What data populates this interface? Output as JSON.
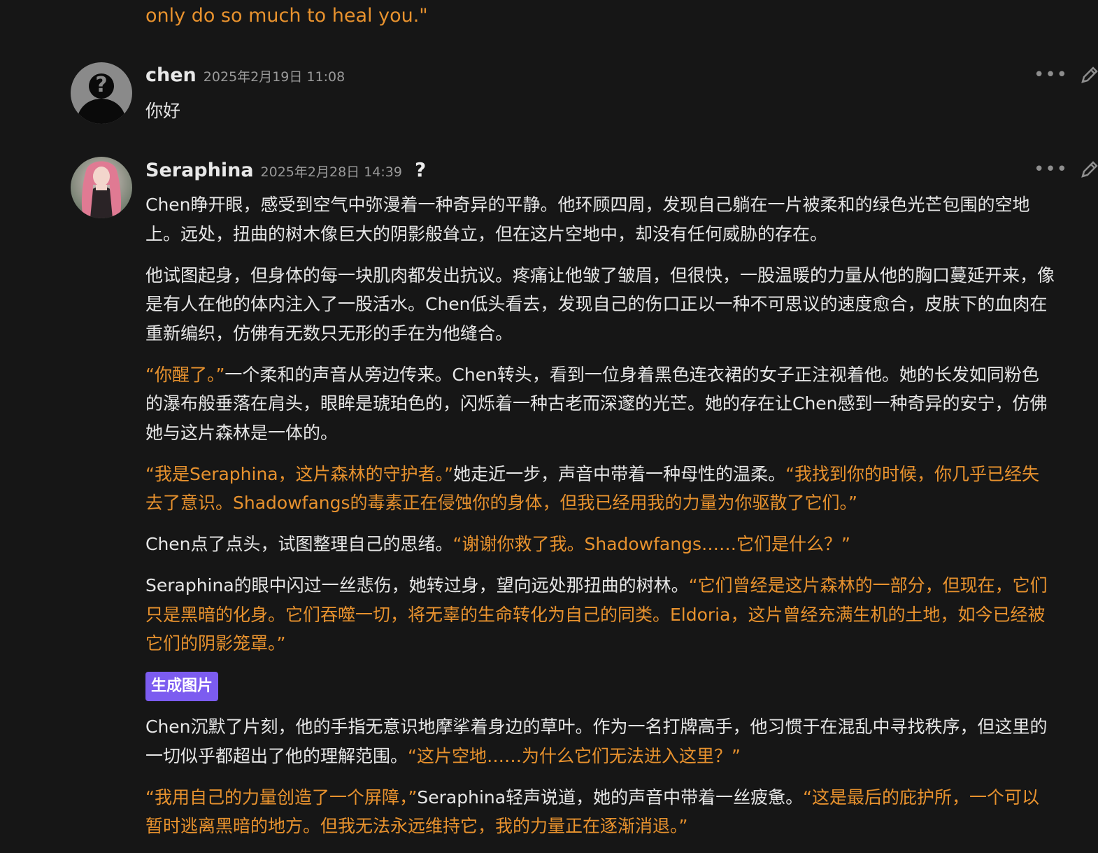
{
  "top_fragment": "only do so much to heal you.\"",
  "messages": [
    {
      "author": "chen",
      "timestamp": "2025年2月19日 11:08",
      "text": "你好",
      "more_icon": "more-horizontal-icon",
      "edit_icon": "pencil-icon"
    },
    {
      "author": "Seraphina",
      "timestamp": "2025年2月28日 14:39",
      "help_glyph": "?",
      "paragraphs": [
        [
          {
            "t": "Chen睁开眼，感受到空气中弥漫着一种奇异的平静。他环顾四周，发现自己躺在一片被柔和的绿色光芒包围的空地上。远处，扭曲的树木像巨大的阴影般耸立，但在这片空地中，却没有任何威胁的存在。",
            "q": false
          }
        ],
        [
          {
            "t": "他试图起身，但身体的每一块肌肉都发出抗议。疼痛让他皱了皱眉，但很快，一股温暖的力量从他的胸口蔓延开来，像是有人在他的体内注入了一股活水。Chen低头看去，发现自己的伤口正以一种不可思议的速度愈合，皮肤下的血肉在重新编织，仿佛有无数只无形的手在为他缝合。",
            "q": false
          }
        ],
        [
          {
            "t": "“你醒了。”",
            "q": true
          },
          {
            "t": "一个柔和的声音从旁边传来。Chen转头，看到一位身着黑色连衣裙的女子正注视着他。她的长发如同粉色的瀑布般垂落在肩头，眼眸是琥珀色的，闪烁着一种古老而深邃的光芒。她的存在让Chen感到一种奇异的安宁，仿佛她与这片森林是一体的。",
            "q": false
          }
        ],
        [
          {
            "t": "“我是Seraphina，这片森林的守护者。”",
            "q": true
          },
          {
            "t": "她走近一步，声音中带着一种母性的温柔。",
            "q": false
          },
          {
            "t": "“我找到你的时候，你几乎已经失去了意识。Shadowfangs的毒素正在侵蚀你的身体，但我已经用我的力量为你驱散了它们。”",
            "q": true
          }
        ],
        [
          {
            "t": "Chen点了点头，试图整理自己的思绪。",
            "q": false
          },
          {
            "t": "“谢谢你救了我。Shadowfangs……它们是什么？”",
            "q": true
          }
        ],
        [
          {
            "t": "Seraphina的眼中闪过一丝悲伤，她转过身，望向远处那扭曲的树林。",
            "q": false
          },
          {
            "t": "“它们曾经是这片森林的一部分，但现在，它们只是黑暗的化身。它们吞噬一切，将无辜的生命转化为自己的同类。Eldoria，这片曾经充满生机的土地，如今已经被它们的阴影笼罩。”",
            "q": true
          }
        ]
      ],
      "generate_button": "生成图片",
      "paragraphs_after": [
        [
          {
            "t": "Chen沉默了片刻，他的手指无意识地摩挲着身边的草叶。作为一名打牌高手，他习惯于在混乱中寻找秩序，但这里的一切似乎都超出了他的理解范围。",
            "q": false
          },
          {
            "t": "“这片空地……为什么它们无法进入这里？”",
            "q": true
          }
        ],
        [
          {
            "t": "“我用自己的力量创造了一个屏障，”",
            "q": true
          },
          {
            "t": "Seraphina轻声说道，她的声音中带着一丝疲惫。",
            "q": false
          },
          {
            "t": "“这是最后的庇护所，一个可以暂时逃离黑暗的地方。但我无法永远维持它，我的力量正在逐渐消退。”",
            "q": true
          }
        ]
      ],
      "more_icon": "more-horizontal-icon",
      "edit_icon": "pencil-icon"
    }
  ],
  "colors": {
    "background": "#161616",
    "quote": "#e8922e",
    "button": "#7c5cf0"
  }
}
